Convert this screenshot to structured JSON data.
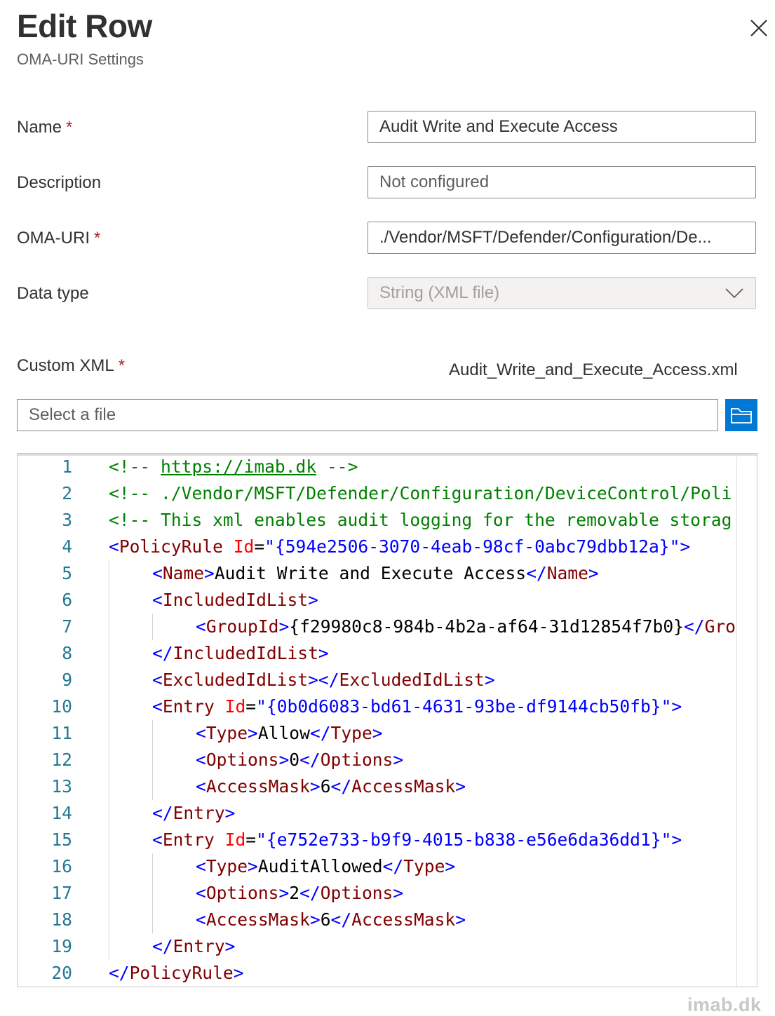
{
  "panel": {
    "title": "Edit Row",
    "subtitle": "OMA-URI Settings",
    "close_icon": "close-icon"
  },
  "form": {
    "name": {
      "label": "Name",
      "required": "*",
      "value": "Audit Write and Execute Access"
    },
    "description": {
      "label": "Description",
      "placeholder": "Not configured"
    },
    "oma_uri": {
      "label": "OMA-URI",
      "required": "*",
      "value": "./Vendor/MSFT/Defender/Configuration/De..."
    },
    "data_type": {
      "label": "Data type",
      "value": "String (XML file)",
      "icon": "chevron-down-icon"
    },
    "custom_xml": {
      "label": "Custom XML",
      "required": "*",
      "file_name": "Audit_Write_and_Execute_Access.xml",
      "file_placeholder": "Select a file",
      "browse_icon": "folder-icon"
    }
  },
  "editor": {
    "lines": [
      {
        "n": "1",
        "indent": 0,
        "tokens": [
          [
            "c-comment",
            "<!-- "
          ],
          [
            "c-link",
            "https://imab.dk"
          ],
          [
            "c-comment",
            " -->"
          ]
        ]
      },
      {
        "n": "2",
        "indent": 0,
        "tokens": [
          [
            "c-comment",
            "<!-- ./Vendor/MSFT/Defender/Configuration/DeviceControl/Poli"
          ]
        ]
      },
      {
        "n": "3",
        "indent": 0,
        "tokens": [
          [
            "c-comment",
            "<!-- This xml enables audit logging for the removable storag"
          ]
        ]
      },
      {
        "n": "4",
        "indent": 0,
        "tokens": [
          [
            "c-bracket",
            "<"
          ],
          [
            "c-tag",
            "PolicyRule"
          ],
          [
            "c-text",
            " "
          ],
          [
            "c-attr",
            "Id"
          ],
          [
            "c-eq",
            "="
          ],
          [
            "c-val",
            "\"{594e2506-3070-4eab-98cf-0abc79dbb12a}\""
          ],
          [
            "c-bracket",
            ">"
          ]
        ]
      },
      {
        "n": "5",
        "indent": 1,
        "tokens": [
          [
            "c-bracket",
            "<"
          ],
          [
            "c-tag",
            "Name"
          ],
          [
            "c-bracket",
            ">"
          ],
          [
            "c-text",
            "Audit Write and Execute Access"
          ],
          [
            "c-bracket",
            "</"
          ],
          [
            "c-tag",
            "Name"
          ],
          [
            "c-bracket",
            ">"
          ]
        ]
      },
      {
        "n": "6",
        "indent": 1,
        "tokens": [
          [
            "c-bracket",
            "<"
          ],
          [
            "c-tag",
            "IncludedIdList"
          ],
          [
            "c-bracket",
            ">"
          ]
        ]
      },
      {
        "n": "7",
        "indent": 2,
        "tokens": [
          [
            "c-bracket",
            "<"
          ],
          [
            "c-tag",
            "GroupId"
          ],
          [
            "c-bracket",
            ">"
          ],
          [
            "c-text",
            "{f29980c8-984b-4b2a-af64-31d12854f7b0}"
          ],
          [
            "c-bracket",
            "</"
          ],
          [
            "c-tag",
            "Gro"
          ]
        ]
      },
      {
        "n": "8",
        "indent": 1,
        "tokens": [
          [
            "c-bracket",
            "</"
          ],
          [
            "c-tag",
            "IncludedIdList"
          ],
          [
            "c-bracket",
            ">"
          ]
        ]
      },
      {
        "n": "9",
        "indent": 1,
        "tokens": [
          [
            "c-bracket",
            "<"
          ],
          [
            "c-tag",
            "ExcludedIdList"
          ],
          [
            "c-bracket",
            "></"
          ],
          [
            "c-tag",
            "ExcludedIdList"
          ],
          [
            "c-bracket",
            ">"
          ]
        ]
      },
      {
        "n": "10",
        "indent": 1,
        "tokens": [
          [
            "c-bracket",
            "<"
          ],
          [
            "c-tag",
            "Entry"
          ],
          [
            "c-text",
            " "
          ],
          [
            "c-attr",
            "Id"
          ],
          [
            "c-eq",
            "="
          ],
          [
            "c-val",
            "\"{0b0d6083-bd61-4631-93be-df9144cb50fb}\""
          ],
          [
            "c-bracket",
            ">"
          ]
        ]
      },
      {
        "n": "11",
        "indent": 2,
        "tokens": [
          [
            "c-bracket",
            "<"
          ],
          [
            "c-tag",
            "Type"
          ],
          [
            "c-bracket",
            ">"
          ],
          [
            "c-text",
            "Allow"
          ],
          [
            "c-bracket",
            "</"
          ],
          [
            "c-tag",
            "Type"
          ],
          [
            "c-bracket",
            ">"
          ]
        ]
      },
      {
        "n": "12",
        "indent": 2,
        "tokens": [
          [
            "c-bracket",
            "<"
          ],
          [
            "c-tag",
            "Options"
          ],
          [
            "c-bracket",
            ">"
          ],
          [
            "c-text",
            "0"
          ],
          [
            "c-bracket",
            "</"
          ],
          [
            "c-tag",
            "Options"
          ],
          [
            "c-bracket",
            ">"
          ]
        ]
      },
      {
        "n": "13",
        "indent": 2,
        "tokens": [
          [
            "c-bracket",
            "<"
          ],
          [
            "c-tag",
            "AccessMask"
          ],
          [
            "c-bracket",
            ">"
          ],
          [
            "c-text",
            "6"
          ],
          [
            "c-bracket",
            "</"
          ],
          [
            "c-tag",
            "AccessMask"
          ],
          [
            "c-bracket",
            ">"
          ]
        ]
      },
      {
        "n": "14",
        "indent": 1,
        "tokens": [
          [
            "c-bracket",
            "</"
          ],
          [
            "c-tag",
            "Entry"
          ],
          [
            "c-bracket",
            ">"
          ]
        ]
      },
      {
        "n": "15",
        "indent": 1,
        "tokens": [
          [
            "c-bracket",
            "<"
          ],
          [
            "c-tag",
            "Entry"
          ],
          [
            "c-text",
            " "
          ],
          [
            "c-attr",
            "Id"
          ],
          [
            "c-eq",
            "="
          ],
          [
            "c-val",
            "\"{e752e733-b9f9-4015-b838-e56e6da36dd1}\""
          ],
          [
            "c-bracket",
            ">"
          ]
        ]
      },
      {
        "n": "16",
        "indent": 2,
        "tokens": [
          [
            "c-bracket",
            "<"
          ],
          [
            "c-tag",
            "Type"
          ],
          [
            "c-bracket",
            ">"
          ],
          [
            "c-text",
            "AuditAllowed"
          ],
          [
            "c-bracket",
            "</"
          ],
          [
            "c-tag",
            "Type"
          ],
          [
            "c-bracket",
            ">"
          ]
        ]
      },
      {
        "n": "17",
        "indent": 2,
        "tokens": [
          [
            "c-bracket",
            "<"
          ],
          [
            "c-tag",
            "Options"
          ],
          [
            "c-bracket",
            ">"
          ],
          [
            "c-text",
            "2"
          ],
          [
            "c-bracket",
            "</"
          ],
          [
            "c-tag",
            "Options"
          ],
          [
            "c-bracket",
            ">"
          ]
        ]
      },
      {
        "n": "18",
        "indent": 2,
        "tokens": [
          [
            "c-bracket",
            "<"
          ],
          [
            "c-tag",
            "AccessMask"
          ],
          [
            "c-bracket",
            ">"
          ],
          [
            "c-text",
            "6"
          ],
          [
            "c-bracket",
            "</"
          ],
          [
            "c-tag",
            "AccessMask"
          ],
          [
            "c-bracket",
            ">"
          ]
        ]
      },
      {
        "n": "19",
        "indent": 1,
        "tokens": [
          [
            "c-bracket",
            "</"
          ],
          [
            "c-tag",
            "Entry"
          ],
          [
            "c-bracket",
            ">"
          ]
        ]
      },
      {
        "n": "20",
        "indent": 0,
        "tokens": [
          [
            "c-bracket",
            "</"
          ],
          [
            "c-tag",
            "PolicyRule"
          ],
          [
            "c-bracket",
            ">"
          ]
        ]
      }
    ]
  },
  "watermark": "imab.dk"
}
